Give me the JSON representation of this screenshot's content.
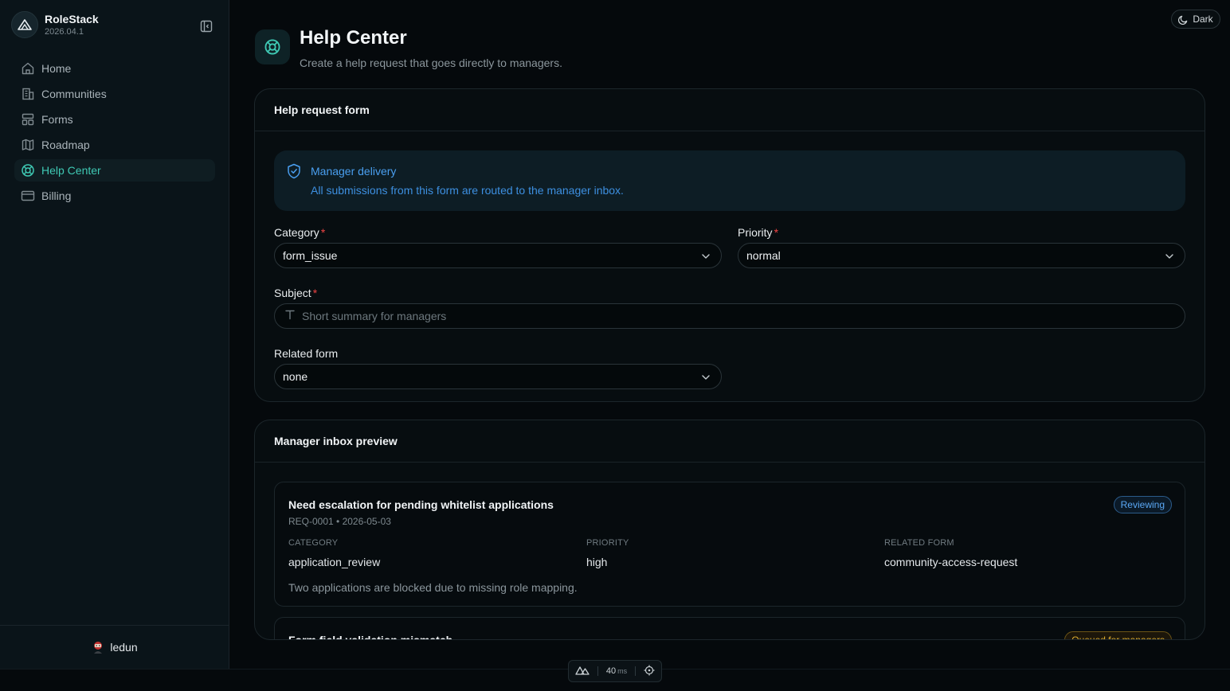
{
  "app": {
    "name": "RoleStack",
    "version": "2026.04.1"
  },
  "sidebar": {
    "items": [
      {
        "label": "Home",
        "icon": "home-icon",
        "active": false
      },
      {
        "label": "Communities",
        "icon": "building-icon",
        "active": false
      },
      {
        "label": "Forms",
        "icon": "layout-icon",
        "active": false
      },
      {
        "label": "Roadmap",
        "icon": "map-icon",
        "active": false
      },
      {
        "label": "Help Center",
        "icon": "lifebuoy-icon",
        "active": true
      },
      {
        "label": "Billing",
        "icon": "credit-card-icon",
        "active": false
      }
    ],
    "user": {
      "name": "ledun"
    }
  },
  "theme_toggle": {
    "label": "Dark"
  },
  "header": {
    "title": "Help Center",
    "subtitle": "Create a help request that goes directly to managers."
  },
  "form": {
    "title": "Help request form",
    "notice": {
      "title": "Manager delivery",
      "text": "All submissions from this form are routed to the manager inbox."
    },
    "category": {
      "label": "Category",
      "value": "form_issue"
    },
    "priority": {
      "label": "Priority",
      "value": "normal"
    },
    "subject": {
      "label": "Subject",
      "placeholder": "Short summary for managers",
      "value": ""
    },
    "related_form": {
      "label": "Related form",
      "value": "none"
    },
    "required_marker": "*"
  },
  "inbox": {
    "title": "Manager inbox preview",
    "field_labels": {
      "category": "CATEGORY",
      "priority": "PRIORITY",
      "related_form": "RELATED FORM"
    },
    "requests": [
      {
        "title": "Need escalation for pending whitelist applications",
        "meta": "REQ-0001 • 2026-05-03",
        "status": "Reviewing",
        "category": "application_review",
        "priority": "high",
        "related_form": "community-access-request",
        "description": "Two applications are blocked due to missing role mapping."
      },
      {
        "title": "Form field validation mismatch",
        "status": "Queued for managers"
      }
    ]
  },
  "devbar": {
    "latency": "40",
    "unit": "ms"
  },
  "colors": {
    "accent": "#3fc9b4",
    "info": "#4a9ff0",
    "required": "#ef4444",
    "reviewing": "#5aa8f5",
    "queued": "#e0b030"
  }
}
